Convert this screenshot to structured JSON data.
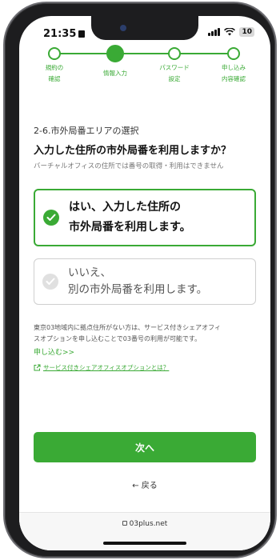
{
  "status_bar": {
    "time": "21:35",
    "battery": "10"
  },
  "stepper": {
    "steps": [
      {
        "label_1": "規約の",
        "label_2": "確認"
      },
      {
        "label_1": "情報入力",
        "label_2": ""
      },
      {
        "label_1": "パスワード",
        "label_2": "設定"
      },
      {
        "label_1": "申し込み",
        "label_2": "内容確認"
      }
    ],
    "active_index": 1
  },
  "form": {
    "section_label": "2-6.市外局番エリアの選択",
    "question": "入力した住所の市外局番を利用しますか？",
    "note": "バーチャルオフィスの住所では番号の取得・利用はできません",
    "options": [
      {
        "line_1": "はい、入力した住所の",
        "line_2": "市外局番を利用します。",
        "selected": true
      },
      {
        "line_1": "いいえ、",
        "line_2": "別の市外局番を利用します。",
        "selected": false
      }
    ]
  },
  "info": {
    "text_1": "東京03地域内に拠点住所がない方は、サービス付きシェアオフィ",
    "text_2": "スオプションを申し込むことで03番号の利用が可能です。",
    "apply_link": "申し込む>>",
    "share_office_link": "サービス付きシェアオフィスオプションとは？"
  },
  "actions": {
    "next": "次へ",
    "back": "← 戻る"
  },
  "browser": {
    "url": "03plus.net"
  },
  "colors": {
    "accent": "#3aaa35"
  }
}
